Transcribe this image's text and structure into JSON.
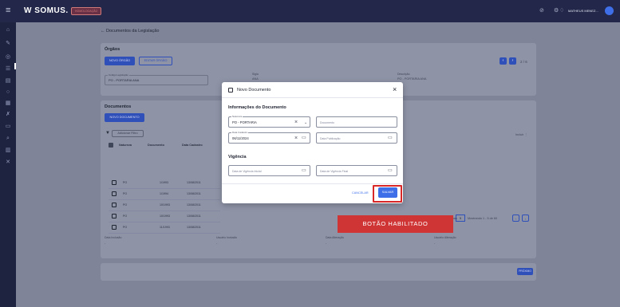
{
  "topbar": {
    "logo": "W SOMUS.",
    "env_badge": "HOMOLOGAÇÃO",
    "user_name": "MATHEUS MENEZ...",
    "avatar_initial": ""
  },
  "page": {
    "back_label": "← Documentos da Legislação"
  },
  "orgaos": {
    "title": "Órgãos",
    "new_button": "NOVO ÓRGÃO",
    "edit_button": "EDITAR ÓRGÃO",
    "pagination": "2 / 6",
    "fields": {
      "codigo_label": "Código Legislação",
      "codigo_value": "PO - PORTARIA ANA",
      "sigla_label": "Sigla",
      "sigla_value": "ANA",
      "descricao_label": "Descrição",
      "descricao_value": "PO - PORTARIA ANA"
    }
  },
  "documentos": {
    "title": "Documentos",
    "new_button": "NOVO DOCUMENTO",
    "filter_button": "Adicionar Filtro",
    "columns": [
      "Natureza",
      "Documento",
      "Data Cadastro"
    ],
    "rows": [
      {
        "natureza": "PO",
        "documento": "1/1993",
        "data": "13/08/2011"
      },
      {
        "natureza": "PO",
        "documento": "1/1994",
        "data": "13/08/2011"
      },
      {
        "natureza": "PO",
        "documento": "10/1993",
        "data": "13/08/2011"
      },
      {
        "natureza": "PO",
        "documento": "10/1993",
        "data": "13/08/2011"
      },
      {
        "natureza": "PO",
        "documento": "11/1993",
        "data": "13/08/2011"
      }
    ],
    "rows_per_page_value": "5",
    "range_label": "Mostrando 1 - 5 de 60",
    "rows_label": "linhas",
    "column_menu": "Incluir ⋮"
  },
  "audit": {
    "data_inclusao_label": "Data Inclusão",
    "usuario_inclusao_label": "Usuário Inclusão",
    "data_alteracao_label": "Data Alteração",
    "usuario_alteracao_label": "Usuário Alteração",
    "empty_value": "-"
  },
  "footer": {
    "next_button": "PRÓXIMO"
  },
  "modal": {
    "title": "Novo Documento",
    "section_info": "Informações do Documento",
    "natureza_label": "Natureza",
    "natureza_value": "PO - PORTARIA",
    "documento_placeholder": "Documento",
    "data_cadastro_label": "Data Cadastro",
    "data_cadastro_value": "06/11/2024",
    "data_publicacao_placeholder": "Data Publicação",
    "section_vigencia": "Vigência",
    "vigencia_inicial_placeholder": "Data de Vigência Inicial",
    "vigencia_final_placeholder": "Data de Vigência Final",
    "cancel_button": "CANCELAR",
    "save_button": "SALVAR"
  },
  "callout": {
    "text": "BOTÃO HABILITADO"
  },
  "colors": {
    "topbar": "#23284a",
    "sidebar": "#1e2340",
    "accent": "#3f6fe8",
    "callout": "#cf3535",
    "highlight": "#d92626"
  }
}
